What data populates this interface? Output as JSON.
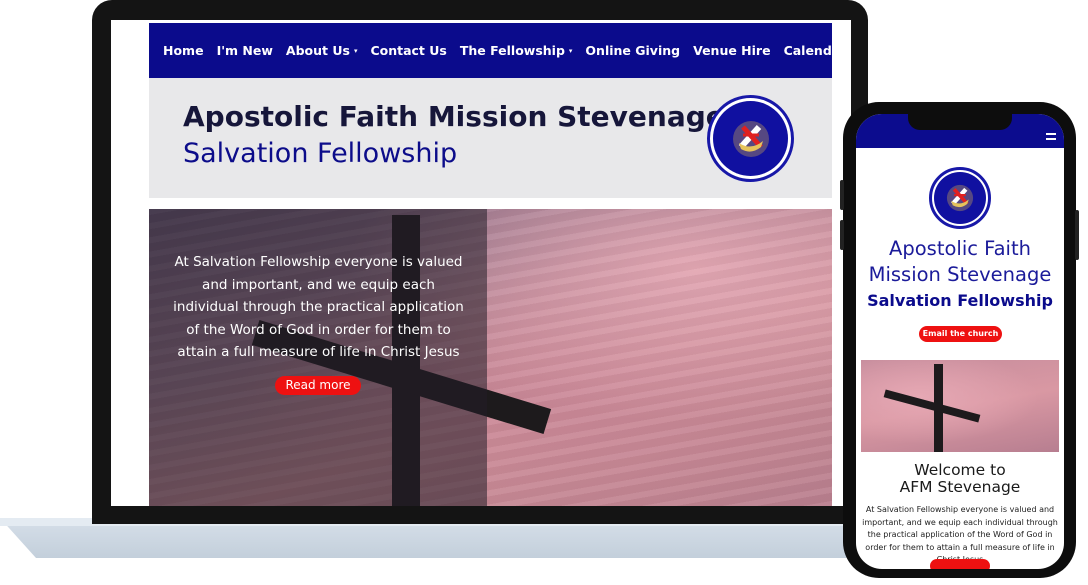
{
  "nav": {
    "items": [
      {
        "label": "Home",
        "has_dropdown": false
      },
      {
        "label": "I'm New",
        "has_dropdown": false
      },
      {
        "label": "About Us",
        "has_dropdown": true
      },
      {
        "label": "Contact Us",
        "has_dropdown": false
      },
      {
        "label": "The Fellowship",
        "has_dropdown": true
      },
      {
        "label": "Online Giving",
        "has_dropdown": false
      },
      {
        "label": "Venue Hire",
        "has_dropdown": false
      },
      {
        "label": "Calendar& Events",
        "has_dropdown": false
      }
    ],
    "caret": "▾"
  },
  "header": {
    "title": "Apostolic Faith Mission Stevenage",
    "subtitle": "Salvation Fellowship",
    "logo_icon": "church-emblem-icon"
  },
  "hero": {
    "text": "At Salvation Fellowship everyone is valued and important, and we equip each individual through the practical application of the Word of God in order for them to attain a full measure of life in Christ Jesus",
    "button_label": "Read more"
  },
  "mobile": {
    "title_line1": "Apostolic Faith",
    "title_line2": "Mission Stevenage",
    "subtitle": "Salvation Fellowship",
    "email_button": "Email the church",
    "welcome_line1": "Welcome to",
    "welcome_line2": "AFM Stevenage",
    "body": "At Salvation Fellowship everyone is valued and important, and we equip each individual through the practical application of the Word of God in order for them to attain a full measure of life in Christ Jesus",
    "menu_icon": "hamburger-menu-icon"
  },
  "colors": {
    "brand_navy": "#0b0b8c",
    "accent_red": "#ee1111",
    "header_gray": "#e8e8ea"
  }
}
